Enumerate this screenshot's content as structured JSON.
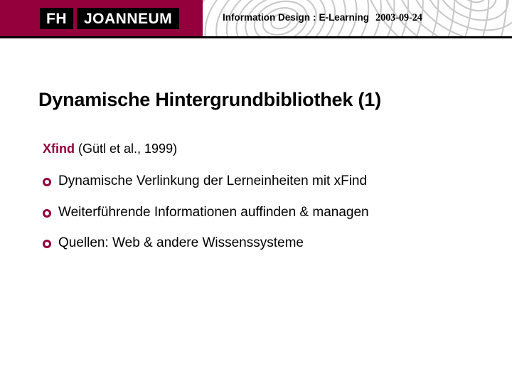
{
  "header": {
    "logo": {
      "part1": "FH",
      "part2": "JOANNEUM"
    },
    "course": "Information Design",
    "separator": ":",
    "topic": "E-Learning",
    "date": "2003-09-24",
    "brand_color": "#93003c",
    "pattern_name": "fingerprint-swirl-pattern"
  },
  "slide": {
    "title": "Dynamische Hintergrundbibliothek (1)",
    "subhead": {
      "keyword": "Xfind",
      "reference": " (Gütl et al., 1999)"
    },
    "bullets": [
      {
        "text": "Dynamische Verlinkung der Lerneinheiten mit xFind"
      },
      {
        "text": "Weiterführende Informationen auffinden & managen"
      },
      {
        "text": "Quellen: Web & andere Wissenssysteme"
      }
    ],
    "bullet_marker_color": "#93003c"
  }
}
